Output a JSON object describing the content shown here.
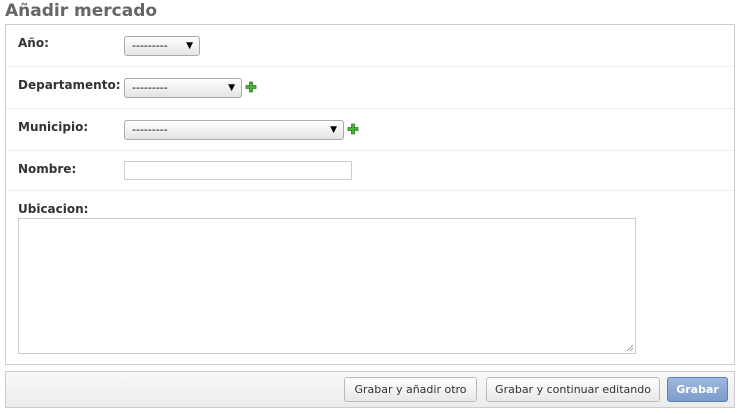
{
  "page": {
    "title": "Añadir mercado"
  },
  "form": {
    "ano": {
      "label": "Año:",
      "selected": "---------"
    },
    "departamento": {
      "label": "Departamento:",
      "selected": "---------",
      "add_icon": "plus-icon"
    },
    "municipio": {
      "label": "Municipio:",
      "selected": "---------",
      "add_icon": "plus-icon"
    },
    "nombre": {
      "label": "Nombre:",
      "value": ""
    },
    "ubicacion": {
      "label": "Ubicacion:",
      "value": ""
    }
  },
  "actions": {
    "save_add_another": "Grabar y añadir otro",
    "save_continue": "Grabar y continuar editando",
    "save": "Grabar"
  },
  "colors": {
    "primary_button": "#7d9ccb",
    "add_icon": "#3a9c2a",
    "title": "#666666"
  }
}
